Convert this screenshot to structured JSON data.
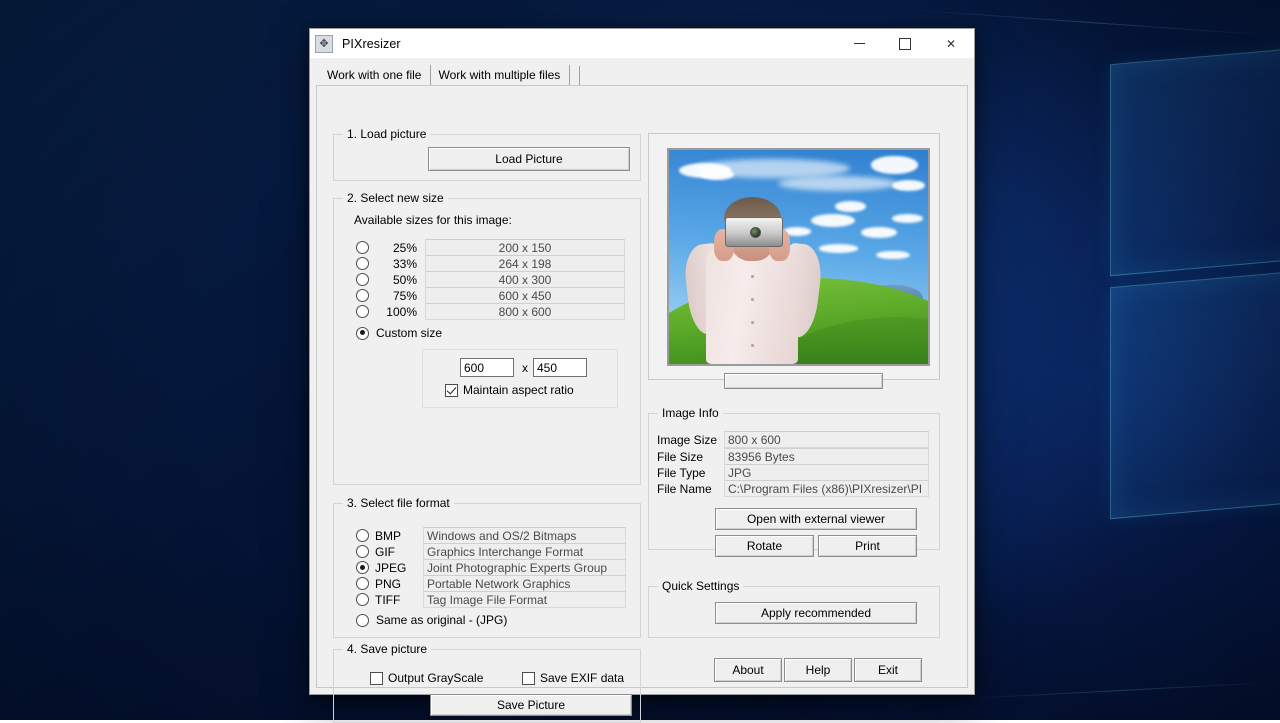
{
  "window": {
    "title": "PIXresizer",
    "icon": "resize-arrows-icon",
    "minimize_label": "Minimize",
    "maximize_label": "Maximize",
    "close_label": "Close"
  },
  "tabs": [
    {
      "label": "Work with one file",
      "active": true
    },
    {
      "label": "Work with multiple files",
      "active": false
    }
  ],
  "load_picture": {
    "group_title": "1. Load picture",
    "button_label": "Load Picture"
  },
  "select_size": {
    "group_title": "2. Select new size",
    "available_label": "Available sizes for this image:",
    "options": [
      {
        "percent": "25%",
        "dimensions": "200 x 150",
        "selected": false
      },
      {
        "percent": "33%",
        "dimensions": "264 x 198",
        "selected": false
      },
      {
        "percent": "50%",
        "dimensions": "400 x 300",
        "selected": false
      },
      {
        "percent": "75%",
        "dimensions": "600 x 450",
        "selected": false
      },
      {
        "percent": "100%",
        "dimensions": "800 x 600",
        "selected": false
      }
    ],
    "custom_size_label": "Custom size",
    "custom_size_selected": true,
    "custom_width": "600",
    "custom_height": "450",
    "times_symbol": "x",
    "maintain_aspect_label": "Maintain aspect ratio",
    "maintain_aspect_checked": true
  },
  "file_format": {
    "group_title": "3. Select file format",
    "options": [
      {
        "name": "BMP",
        "description": "Windows and OS/2 Bitmaps",
        "selected": false
      },
      {
        "name": "GIF",
        "description": "Graphics Interchange Format",
        "selected": false
      },
      {
        "name": "JPEG",
        "description": "Joint Photographic Experts Group",
        "selected": true
      },
      {
        "name": "PNG",
        "description": "Portable Network Graphics",
        "selected": false
      },
      {
        "name": "TIFF",
        "description": "Tag Image File Format",
        "selected": false
      }
    ],
    "same_as_original_label": "Same as original  - (JPG)",
    "same_as_original_selected": false
  },
  "save_picture": {
    "group_title": "4. Save picture",
    "grayscale_label": "Output GrayScale",
    "grayscale_checked": false,
    "exif_label": "Save EXIF data",
    "exif_checked": false,
    "button_label": "Save Picture"
  },
  "image_info": {
    "group_title": "Image Info",
    "rows": [
      {
        "label": "Image Size",
        "value": "800 x 600"
      },
      {
        "label": "File Size",
        "value": "83956 Bytes"
      },
      {
        "label": "File Type",
        "value": "JPG"
      },
      {
        "label": "File Name",
        "value": "C:\\Program Files (x86)\\PIXresizer\\PI"
      }
    ],
    "open_external_label": "Open with external viewer",
    "rotate_label": "Rotate",
    "print_label": "Print"
  },
  "quick_settings": {
    "group_title": "Quick Settings",
    "apply_recommended_label": "Apply recommended"
  },
  "bottom_buttons": {
    "about_label": "About",
    "help_label": "Help",
    "exit_label": "Exit"
  },
  "preview": {
    "alt": "Photographer holding a camera in front of a green hill and blue sky"
  },
  "colors": {
    "window_background": "#f0f0f0",
    "title_background": "#ffffff",
    "button_face": "#efefef",
    "readonly_field": "#eeeeee",
    "desktop": "#04143a"
  }
}
